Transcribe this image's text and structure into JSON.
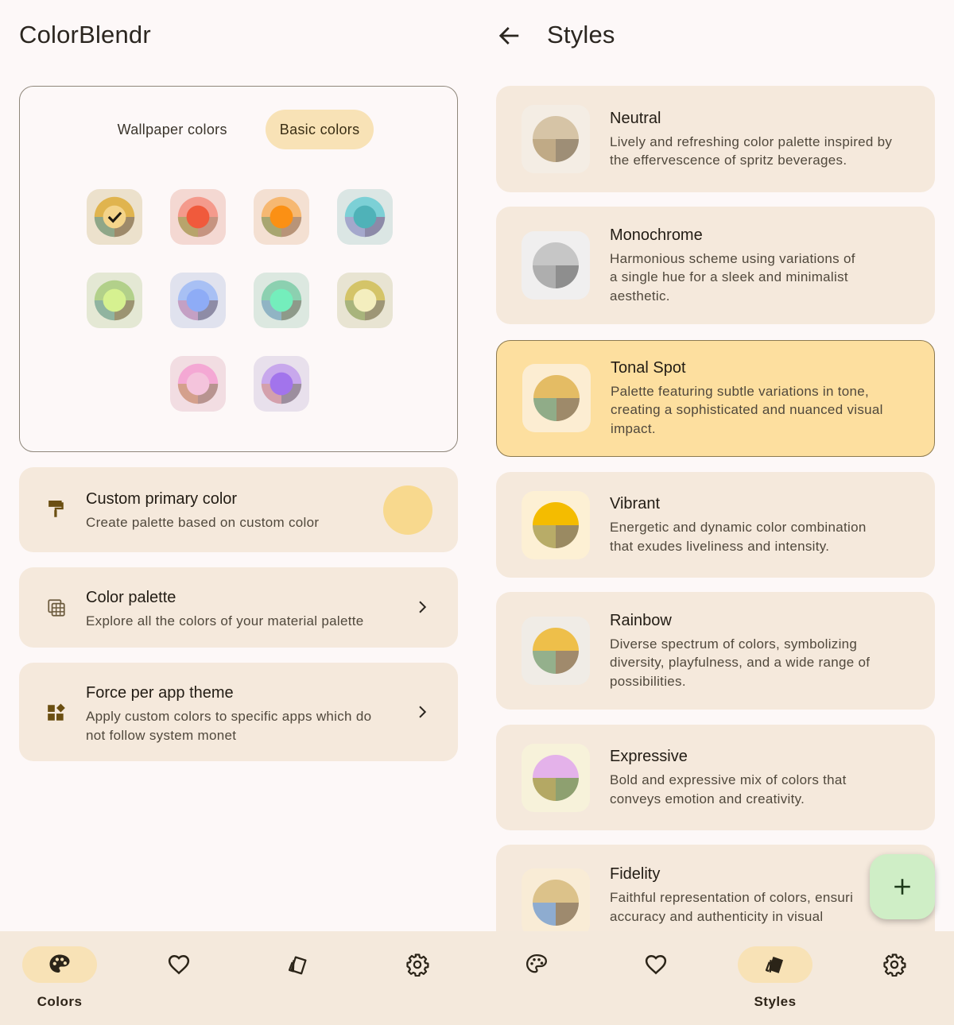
{
  "left": {
    "title": "ColorBlendr",
    "tabs": [
      {
        "label": "Wallpaper colors",
        "active": false
      },
      {
        "label": "Basic colors",
        "active": true
      }
    ],
    "swatches": [
      {
        "bg": "#ece1cc",
        "ring": "#e0b44e",
        "center": "#f4d48a",
        "q1": "#8fa788",
        "q2": "#9e8a6a",
        "selected": true
      },
      {
        "bg": "#f4d8d2",
        "ring": "#f49a8c",
        "center": "#f05a3c",
        "q1": "#b8a46c",
        "q2": "#c69480",
        "selected": false
      },
      {
        "bg": "#f4e0d2",
        "ring": "#f6b872",
        "center": "#fb9014",
        "q1": "#a8a670",
        "q2": "#b89478",
        "selected": false
      },
      {
        "bg": "#dbe6e4",
        "ring": "#7cd0d6",
        "center": "#4fb2b8",
        "q1": "#a4a8cc",
        "q2": "#8c8aa8",
        "selected": false
      },
      {
        "bg": "#e4e8d4",
        "ring": "#b2d08a",
        "center": "#d6f190",
        "q1": "#90b4a0",
        "q2": "#9c9472",
        "selected": false
      },
      {
        "bg": "#e0e2ee",
        "ring": "#a8c0f4",
        "center": "#8eacf6",
        "q1": "#c4a0c4",
        "q2": "#8e8ca6",
        "selected": false
      },
      {
        "bg": "#dce8e0",
        "ring": "#8cd0b0",
        "center": "#74eebc",
        "q1": "#90b4c4",
        "q2": "#8e9a8a",
        "selected": false
      },
      {
        "bg": "#e8e4d2",
        "ring": "#d4c468",
        "center": "#f4eebe",
        "q1": "#a8b47c",
        "q2": "#9e9676",
        "selected": false
      },
      {
        "bg": "#f2dde2",
        "ring": "#f4a8d4",
        "center": "#f4c4dc",
        "q1": "#d4a08c",
        "q2": "#b89490",
        "selected": false
      },
      {
        "bg": "#e8e0ec",
        "ring": "#c8a8ec",
        "center": "#a274ec",
        "q1": "#d4a0ac",
        "q2": "#9c8e9e",
        "selected": false
      }
    ],
    "rows": [
      {
        "title": "Custom primary color",
        "subtitle": "Create palette based on custom color",
        "icon": "paint-roller-icon"
      },
      {
        "title": "Color palette",
        "subtitle": "Explore all the colors of your material palette",
        "icon": "palette-grid-icon"
      },
      {
        "title": "Force per app theme",
        "subtitle_line1": "Apply custom colors to specific apps which do",
        "subtitle_line2": "not follow system monet",
        "icon": "widgets-icon"
      }
    ],
    "custom_color": "#f8d98e",
    "nav": [
      {
        "label": "Colors",
        "icon": "palette-icon",
        "active": true
      },
      {
        "label": "",
        "icon": "heart-icon",
        "active": false
      },
      {
        "label": "",
        "icon": "styles-cards-icon",
        "active": false
      },
      {
        "label": "",
        "icon": "gear-icon",
        "active": false
      }
    ]
  },
  "right": {
    "title": "Styles",
    "styles": [
      {
        "name": "Neutral",
        "lines": [
          "Lively and refreshing color palette inspired by",
          "the effervescence of spritz beverages."
        ],
        "thumb_bg": "#f4ede4",
        "top": "#d6c4a6",
        "bl": "#c0aa86",
        "br": "#9e8e76",
        "selected": false
      },
      {
        "name": "Monochrome",
        "lines": [
          "Harmonious scheme using variations of",
          "a single hue for a sleek and minimalist",
          "aesthetic."
        ],
        "thumb_bg": "#f0efef",
        "top": "#c6c6c6",
        "bl": "#aeaeae",
        "br": "#8e8e8e",
        "selected": false
      },
      {
        "name": "Tonal Spot",
        "lines": [
          "Palette featuring subtle variations in tone,",
          "creating a sophisticated and nuanced visual",
          "impact."
        ],
        "thumb_bg": "#fcedd2",
        "top": "#e4bc64",
        "bl": "#90ac88",
        "br": "#9e8a6a",
        "selected": true
      },
      {
        "name": "Vibrant",
        "lines": [
          "Energetic and dynamic color combination",
          "that exudes liveliness and intensity."
        ],
        "thumb_bg": "#fdf0d4",
        "top": "#f4bc00",
        "bl": "#b8ac68",
        "br": "#9a8a62",
        "selected": false
      },
      {
        "name": "Rainbow",
        "lines": [
          "Diverse spectrum of colors, symbolizing",
          "diversity, playfulness, and a wide range of",
          "possibilities."
        ],
        "thumb_bg": "#f0ece6",
        "top": "#eebf4a",
        "bl": "#94b08c",
        "br": "#a08a6c",
        "selected": false
      },
      {
        "name": "Expressive",
        "lines": [
          "Bold and expressive mix of colors that",
          "conveys emotion and creativity."
        ],
        "thumb_bg": "#f7f2da",
        "top": "#e4b2ea",
        "bl": "#b4a864",
        "br": "#8ea070",
        "selected": false
      },
      {
        "name": "Fidelity",
        "lines": [
          "Faithful representation of colors, ensuri",
          "accuracy and authenticity in visual"
        ],
        "thumb_bg": "#f9ecd6",
        "top": "#dcc28a",
        "bl": "#8eacd0",
        "br": "#9e8a6e",
        "selected": false
      }
    ],
    "fab_icon": "plus-icon",
    "nav": [
      {
        "label": "",
        "icon": "palette-icon",
        "active": false
      },
      {
        "label": "",
        "icon": "heart-icon",
        "active": false
      },
      {
        "label": "Styles",
        "icon": "styles-cards-icon",
        "active": true
      },
      {
        "label": "",
        "icon": "gear-icon",
        "active": false
      }
    ]
  }
}
